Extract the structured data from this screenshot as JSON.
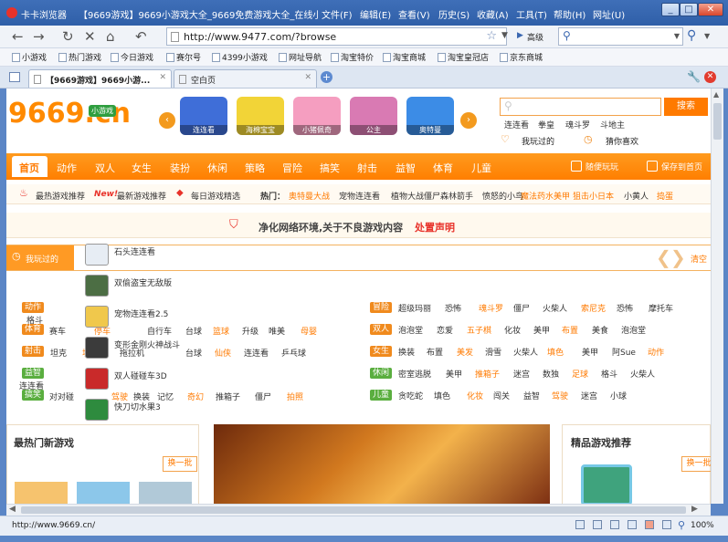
{
  "window": {
    "app_name": "卡卡浏览器",
    "title": "【9669游戏】9669小游戏大全_9669免费游戏大全_在线小游...",
    "menu": [
      "文件(F)",
      "编辑(E)",
      "查看(V)",
      "历史(S)",
      "收藏(A)",
      "工具(T)",
      "帮助(H)",
      "网址(U)"
    ]
  },
  "nav": {
    "url": "http://www.9477.com/?browse",
    "search_engine": "高级"
  },
  "bookmarks": [
    "小游戏",
    "热门游戏",
    "今日游戏",
    "赛尔号",
    "4399小游戏",
    "网址导航",
    "淘宝特价",
    "淘宝商城",
    "淘宝皇冠店",
    "京东商城"
  ],
  "tabs": [
    {
      "label": "【9669游戏】9669小游..."
    },
    {
      "label": "空白页"
    }
  ],
  "site": {
    "logo": "9669.cn",
    "logo_badge": "小游戏",
    "search_button": "搜索",
    "hot_keywords": [
      "连连看",
      "拳皇",
      "魂斗罗",
      "斗地主"
    ],
    "played": "我玩过的",
    "guess": "猜你喜欢",
    "games": [
      "连连看",
      "海棉宝宝",
      "小猪佩奇",
      "公主",
      "奥特曼"
    ],
    "main_nav": [
      "首页",
      "动作",
      "双人",
      "女生",
      "装扮",
      "休闲",
      "策略",
      "冒险",
      "搞笑",
      "射击",
      "益智",
      "体育",
      "儿童"
    ],
    "random_play": "随便玩玩",
    "save_desktop": "保存到首页",
    "sub_links": [
      "最热游戏推荐",
      "最新游戏推荐",
      "每日游戏精选"
    ],
    "new_label": "New!",
    "hot_label": "热门：",
    "hot_list": [
      "奥特曼大战",
      "宠物连连看",
      "植物大战僵尸",
      "森林箭手",
      "愤怒的小鸟",
      "魔法药水美甲",
      "狙击小日本",
      "小黄人",
      "捣蛋"
    ],
    "notice": "净化网络环境,关于不良游戏内容",
    "notice_link": "处置声明",
    "history_label": "我玩过的",
    "history_clear": "清空",
    "dropdown": [
      "石头连连看",
      "双偷盗宝无敌版",
      "宠物连连看2.5",
      "变形金刚火神战斗",
      "双人碰碰车3D",
      "快刀切水果3"
    ],
    "left_rows": [
      {
        "cat": "动作",
        "links": [
          "格斗"
        ]
      },
      {
        "cat": "体育",
        "links": [
          "赛车",
          "停车",
          "自行车",
          "台球",
          "篮球",
          "升级",
          "唯美",
          "母婴"
        ]
      },
      {
        "cat": "射击",
        "links": [
          "坦克",
          "坦克",
          "拖拉机",
          "台球",
          "仙侠",
          "连连看",
          "乒乓球"
        ]
      },
      {
        "cat": "益智",
        "links": [
          "连连看"
        ]
      },
      {
        "cat": "搞笑",
        "links": [
          "对对碰",
          "驾驶",
          "换装",
          "记忆",
          "奇幻",
          "推箱子",
          "僵尸",
          "拍照"
        ]
      }
    ],
    "right_rows": [
      {
        "cat": "冒险",
        "links": [
          "超级玛丽",
          "恐怖",
          "魂斗罗",
          "僵尸",
          "火柴人",
          "索尼克",
          "恐怖",
          "摩托车"
        ]
      },
      {
        "cat": "双人",
        "links": [
          "泡泡堂",
          "恋爱",
          "五子棋",
          "化妆",
          "美甲",
          "布置",
          "美食",
          "泡泡堂"
        ]
      },
      {
        "cat": "女生",
        "links": [
          "换装",
          "布置",
          "美发",
          "滑雪",
          "火柴人",
          "填色",
          "美甲",
          "阿Sue",
          "动作"
        ]
      },
      {
        "cat": "休闲",
        "links": [
          "密室逃脱",
          "美甲",
          "推箱子",
          "迷宫",
          "数独",
          "足球",
          "格斗",
          "火柴人"
        ]
      },
      {
        "cat": "儿童",
        "links": [
          "贪吃蛇",
          "填色",
          "化妆",
          "闯关",
          "益智",
          "驾驶",
          "迷宫",
          "小球"
        ]
      }
    ],
    "section_hot": "最热门新游戏",
    "section_recommend": "精品游戏推荐",
    "refresh": "换一批"
  },
  "status": {
    "url": "http://www.9669.cn/",
    "zoom": "100%"
  },
  "colors": {
    "brand_orange": "#ff7a00",
    "title_blue": "#3568b2",
    "red": "#e8322a"
  }
}
